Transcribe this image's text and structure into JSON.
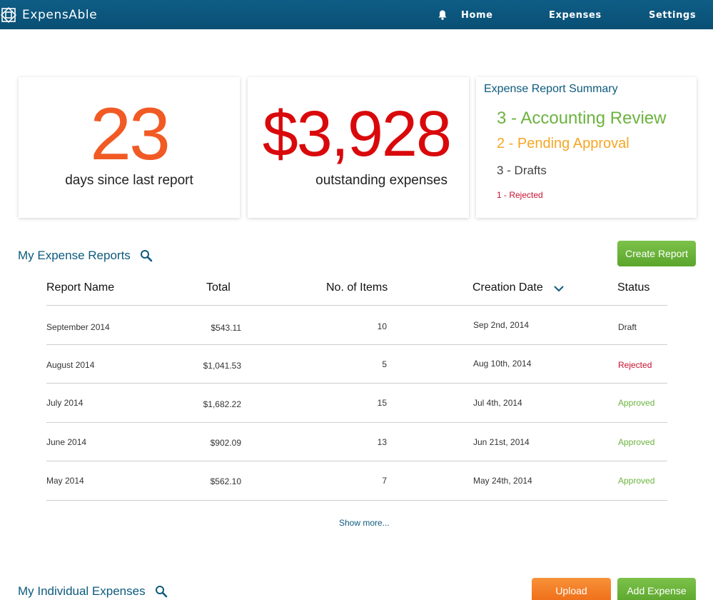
{
  "header": {
    "brand": "ExpensAble",
    "nav": {
      "home": "Home",
      "expenses": "Expenses",
      "settings": "Settings"
    }
  },
  "stats": {
    "days_value": "23",
    "days_caption": "days since last report",
    "amount_value": "$3,928",
    "amount_caption": "outstanding expenses"
  },
  "summary": {
    "title": "Expense Report Summary",
    "accounting_review": "3 - Accounting Review",
    "pending_approval": "2 - Pending Approval",
    "drafts": "3 - Drafts",
    "rejected": "1 - Rejected"
  },
  "reports": {
    "title": "My Expense Reports",
    "create_button": "Create Report",
    "columns": [
      "Report Name",
      "Total",
      "No. of Items",
      "Creation Date",
      "Status"
    ],
    "rows": [
      {
        "name": "September 2014",
        "total": "$543.11",
        "items": "10",
        "date": "Sep 2nd, 2014",
        "status": "Draft"
      },
      {
        "name": "August 2014",
        "total": "$1,041.53",
        "items": "5",
        "date": "Aug 10th, 2014",
        "status": "Rejected"
      },
      {
        "name": "July 2014",
        "total": "$1,682.22",
        "items": "15",
        "date": "Jul 4th, 2014",
        "status": "Approved"
      },
      {
        "name": "June 2014",
        "total": "$902.09",
        "items": "13",
        "date": "Jun 21st, 2014",
        "status": "Approved"
      },
      {
        "name": "May 2014",
        "total": "$562.10",
        "items": "7",
        "date": "May 24th, 2014",
        "status": "Approved"
      }
    ],
    "show_more": "Show more..."
  },
  "individual": {
    "title": "My Individual Expenses",
    "upload_button": "Upload",
    "add_button": "Add Expense"
  },
  "colors": {
    "header": "#0a4f74",
    "days": "#f15a24",
    "amount": "#d9090b",
    "approved": "#6cb33f",
    "pending": "#f5a623",
    "rejected": "#c8102e"
  }
}
